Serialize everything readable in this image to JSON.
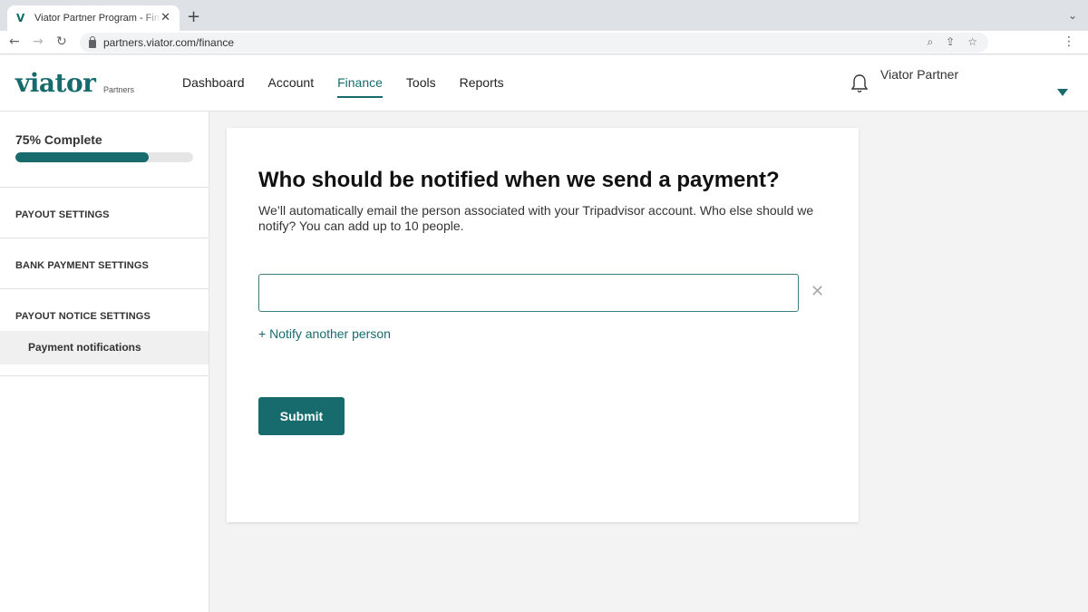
{
  "browser": {
    "tab_title": "Viator Partner Program - Finance",
    "favicon": "V",
    "url": "partners.viator.com/finance"
  },
  "header": {
    "logo_text": "viator",
    "logo_sub": "Partners",
    "nav": [
      {
        "label": "Dashboard"
      },
      {
        "label": "Account"
      },
      {
        "label": "Finance"
      },
      {
        "label": "Tools"
      },
      {
        "label": "Reports"
      }
    ],
    "active_nav": "Finance",
    "user_name": "Viator Partner"
  },
  "sidebar": {
    "progress_label": "75% Complete",
    "progress_fraction": 0.75,
    "sections": [
      {
        "heading": "PAYOUT SETTINGS"
      },
      {
        "heading": "BANK PAYMENT SETTINGS"
      },
      {
        "heading": "PAYOUT NOTICE SETTINGS",
        "sub": "Payment notifications"
      }
    ]
  },
  "main": {
    "title": "Who should be notified when we send a payment?",
    "description": "We’ll automatically email the person associated with your Tripadvisor account. Who else should we notify? You can add up to 10 people.",
    "email_value": "",
    "add_link": "+ Notify another person",
    "submit_label": "Submit"
  },
  "colors": {
    "brand": "#186b6d",
    "background": "#f3f3f3"
  }
}
